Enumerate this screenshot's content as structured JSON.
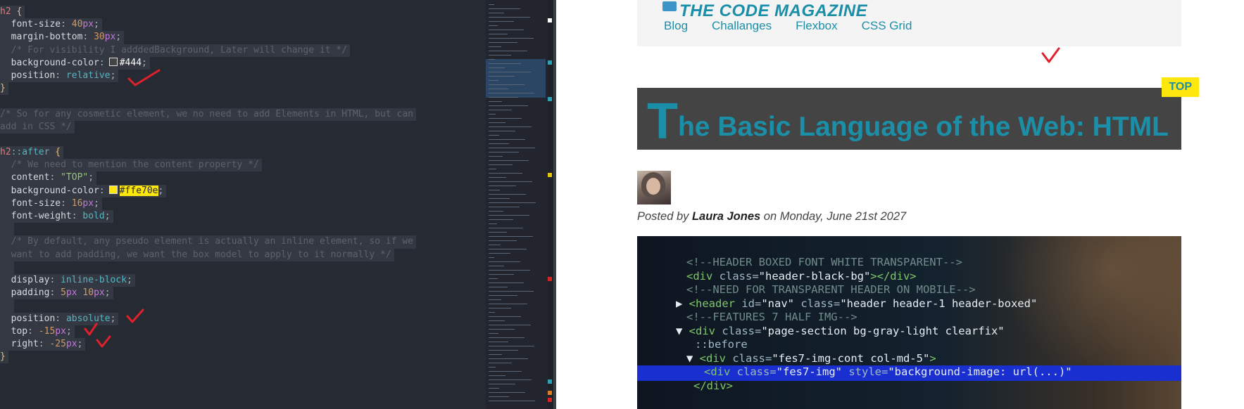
{
  "editor": {
    "lines": [
      {
        "kind": "sel",
        "text": "h2 {"
      },
      {
        "kind": "decl",
        "prop": "font-size",
        "num": "40",
        "unit": "px"
      },
      {
        "kind": "decl",
        "prop": "margin-bottom",
        "num": "30",
        "unit": "px"
      },
      {
        "kind": "comment",
        "text": "  /* For visibility I adddedBackground, Later will change it */"
      },
      {
        "kind": "decl-color",
        "prop": "background-color",
        "swatch": "#444444",
        "value": "#444"
      },
      {
        "kind": "decl-kw",
        "prop": "position",
        "value": "relative"
      },
      {
        "kind": "close",
        "text": "}"
      },
      {
        "kind": "blank"
      },
      {
        "kind": "comment0",
        "text": "/* So for any cosmetic element, we no need to add Elements in HTML, but can"
      },
      {
        "kind": "comment0",
        "text": "add in CSS */"
      },
      {
        "kind": "blank"
      },
      {
        "kind": "sel-pseudo",
        "sel": "h2",
        "pseudo": "::after",
        "rest": " {"
      },
      {
        "kind": "comment",
        "text": "  /* We need to mention the content property */"
      },
      {
        "kind": "decl-str",
        "prop": "content",
        "value": "\"TOP\""
      },
      {
        "kind": "decl-color-y",
        "prop": "background-color",
        "swatch": "#ffe70e",
        "value": "#ffe70e"
      },
      {
        "kind": "decl",
        "prop": "font-size",
        "num": "16",
        "unit": "px"
      },
      {
        "kind": "decl-kw",
        "prop": "font-weight",
        "value": "bold"
      },
      {
        "kind": "blank-i"
      },
      {
        "kind": "comment",
        "text": "  /* By default, any pseudo element is actually an inline element, so if we"
      },
      {
        "kind": "comment",
        "text": "  want to add padding, we want the box model to apply to it normally */"
      },
      {
        "kind": "blank-i"
      },
      {
        "kind": "decl-kw",
        "prop": "display",
        "value": "inline-block"
      },
      {
        "kind": "decl-pad",
        "prop": "padding",
        "a": "5",
        "b": "10"
      },
      {
        "kind": "blank-i"
      },
      {
        "kind": "decl-kw",
        "prop": "position",
        "value": "absolute"
      },
      {
        "kind": "decl",
        "prop": "top",
        "num": "-15",
        "unit": "px"
      },
      {
        "kind": "decl",
        "prop": "right",
        "num": "-25",
        "unit": "px"
      },
      {
        "kind": "close",
        "text": "}"
      }
    ]
  },
  "site": {
    "title": "THE CODE MAGAZINE",
    "nav": [
      "Blog",
      "Challanges",
      "Flexbox",
      "CSS Grid"
    ],
    "badge": "TOP",
    "heading_first": "T",
    "heading_rest": "he Basic Language of the Web: HTML",
    "byline_pre": "Posted by ",
    "author": "Laura Jones",
    "byline_post": " on Monday, June 21st 2027"
  },
  "code_image_lines": [
    {
      "parts": [
        [
          "img-com",
          "<!--HEADER BOXED FONT WHITE TRANSPARENT-->"
        ]
      ]
    },
    {
      "parts": [
        [
          "img-tag",
          "<div "
        ],
        [
          "img-attr",
          "class="
        ],
        [
          "img-val",
          "\"header-black-bg\""
        ],
        [
          "img-tag",
          "></div>"
        ]
      ]
    },
    {
      "parts": [
        [
          "img-com",
          "<!--NEED FOR TRANSPARENT HEADER ON MOBILE-->"
        ]
      ]
    },
    {
      "parts": [
        [
          "img-val",
          "▶ "
        ],
        [
          "img-tag",
          "<header "
        ],
        [
          "img-attr",
          "id="
        ],
        [
          "img-val",
          "\"nav\" "
        ],
        [
          "img-attr",
          "class="
        ],
        [
          "img-val",
          "\"header header-1 header-boxed\""
        ]
      ]
    },
    {
      "parts": [
        [
          "img-com",
          "<!--FEATURES 7 HALF IMG-->"
        ]
      ]
    },
    {
      "parts": [
        [
          "img-val",
          "▼ "
        ],
        [
          "img-tag",
          "<div "
        ],
        [
          "img-attr",
          "class="
        ],
        [
          "img-val",
          "\"page-section bg-gray-light clearfix\""
        ]
      ]
    },
    {
      "parts": [
        [
          "img-attr",
          "::before"
        ]
      ]
    },
    {
      "parts": [
        [
          "img-val",
          "▼ "
        ],
        [
          "img-tag",
          "<div "
        ],
        [
          "img-attr",
          "class="
        ],
        [
          "img-val",
          "\"fes7-img-cont col-md-5\""
        ],
        [
          "img-tag",
          ">"
        ]
      ]
    },
    {
      "parts": [
        [
          "img-tag",
          "<div "
        ],
        [
          "img-attr",
          "class="
        ],
        [
          "img-val",
          "\"fes7-img\" "
        ],
        [
          "img-attr",
          "style="
        ],
        [
          "img-val",
          "\"background-image: url(...)\""
        ]
      ]
    },
    {
      "parts": [
        [
          "img-tag",
          "</div>"
        ]
      ]
    }
  ],
  "icons": {
    "book": "book-icon",
    "checkmark": "checkmark-annotation"
  },
  "colors": {
    "editor_bg": "#262a33",
    "accent": "#1b8fa8",
    "heading_bg": "#444444",
    "badge_bg": "#ffe70e",
    "annotation": "#e0202a"
  }
}
